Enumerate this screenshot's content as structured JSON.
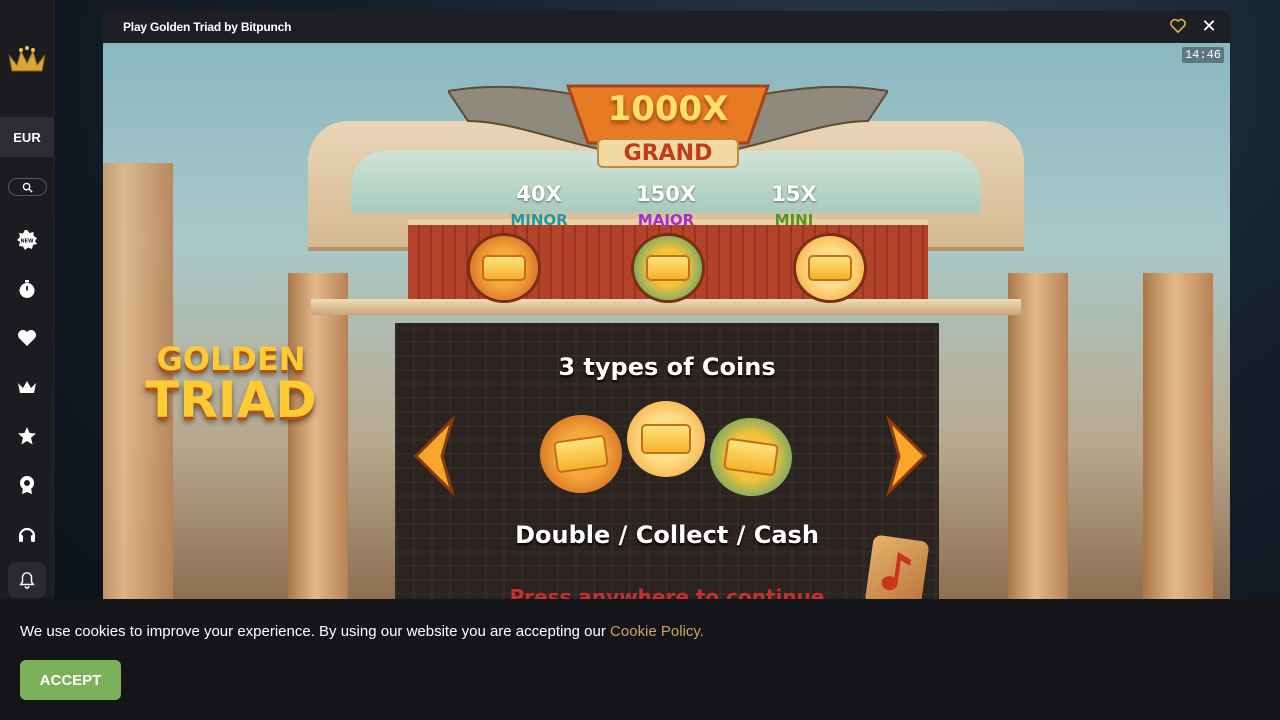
{
  "sidebar": {
    "logo": "crown-logo",
    "currency": "EUR",
    "icons": [
      "search-icon",
      "new-badge-icon",
      "stopwatch-icon",
      "heart-icon",
      "crown-icon",
      "star-icon",
      "award-icon",
      "headset-icon",
      "bell-icon"
    ]
  },
  "modal": {
    "title": "Play Golden Triad by Bitpunch",
    "close_glyph": "✕"
  },
  "game": {
    "clock": "14:46",
    "grand": {
      "multiplier": "1000X",
      "label": "GRAND"
    },
    "jackpots": [
      {
        "value": "40X",
        "name": "MINOR",
        "color": "#1d9aa6"
      },
      {
        "value": "150X",
        "name": "MAJOR",
        "color": "#a530c8"
      },
      {
        "value": "15X",
        "name": "MINI",
        "color": "#4d9a1e"
      }
    ],
    "logo_line1": "GOLDEN",
    "logo_line2": "TRIAD",
    "headline": "3 types of Coins",
    "subline": "Double / Collect / Cash",
    "press": "Press anywhere to continue"
  },
  "cookie": {
    "text": "We use cookies to improve your experience. By using our website you are accepting our ",
    "link": "Cookie Policy.",
    "accept": "ACCEPT"
  },
  "colors": {
    "accent_green": "#7db05a",
    "link_gold": "#c9a368",
    "sidebar_bg": "#1b1c20"
  }
}
